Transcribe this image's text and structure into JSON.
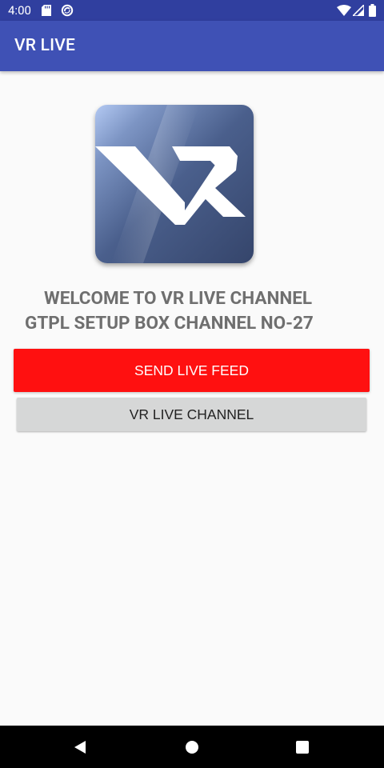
{
  "status_bar": {
    "time": "4:00",
    "icons": [
      "sd-card-icon",
      "sync-icon",
      "wifi-icon",
      "cell-signal-icon",
      "battery-icon"
    ]
  },
  "app_bar": {
    "title": "VR LIVE",
    "color": "#3f51b5"
  },
  "logo": {
    "text": "VR"
  },
  "welcome": {
    "line1": "WELCOME TO VR LIVE CHANNEL",
    "line2": "GTPL SETUP BOX CHANNEL NO-27"
  },
  "buttons": {
    "send_live_feed": {
      "label": "SEND LIVE FEED",
      "color": "#ff1010"
    },
    "vr_live_channel": {
      "label": "VR LIVE CHANNEL",
      "color": "#d6d7d7"
    }
  },
  "nav": {
    "icons": [
      "back-icon",
      "home-icon",
      "recents-icon"
    ]
  }
}
